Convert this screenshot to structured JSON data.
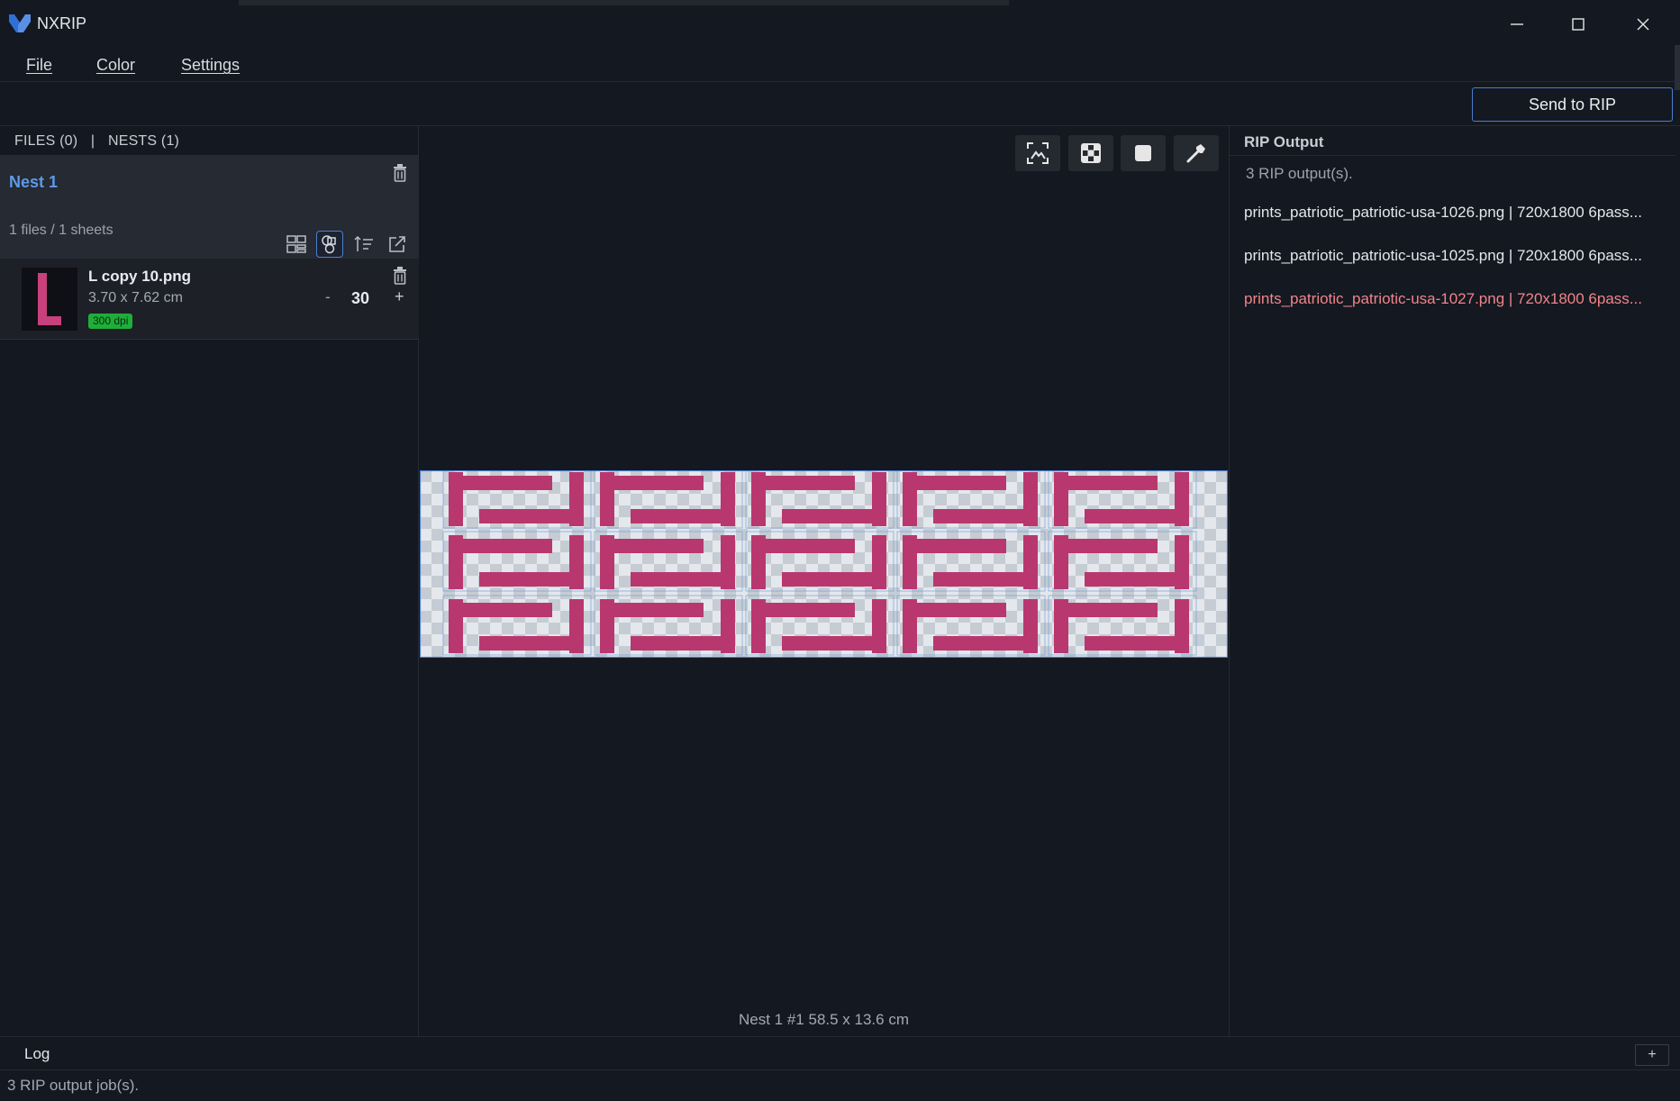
{
  "app": {
    "title": "NXRIP",
    "brand_color": "#2f6fd8"
  },
  "window_controls": {
    "minimize": "—",
    "maximize": "☐",
    "close": "✕"
  },
  "menu": {
    "file": "File",
    "color": "Color",
    "settings": "Settings"
  },
  "toolbar": {
    "send_label": "Send to RIP"
  },
  "left": {
    "files_tab": "FILES (0)",
    "separator": "|",
    "nests_tab": "NESTS (1)",
    "nest": {
      "title": "Nest 1",
      "meta": "1 files / 1 sheets"
    },
    "file": {
      "name": "L copy 10.png",
      "size": "3.70 x 7.62 cm",
      "dpi": "300 dpi",
      "qty_minus": "-",
      "quantity": "30",
      "qty_plus": "+",
      "thumb_color": "#c8407c"
    }
  },
  "canvas": {
    "caption": "Nest 1 #1  58.5 x 13.6 cm",
    "print_color": "#b9376f",
    "grid": {
      "columns": 5,
      "rows": 3
    }
  },
  "right": {
    "header": "RIP Output",
    "count": "3 RIP output(s).",
    "items": [
      {
        "text": "prints_patriotic_patriotic-usa-1026.png | 720x1800 6pass...",
        "status": "ok"
      },
      {
        "text": "prints_patriotic_patriotic-usa-1025.png | 720x1800 6pass...",
        "status": "ok"
      },
      {
        "text": "prints_patriotic_patriotic-usa-1027.png | 720x1800 6pass...",
        "status": "error"
      }
    ]
  },
  "log": {
    "label": "Log",
    "add": "+",
    "last_line": "3 RIP output job(s)."
  }
}
